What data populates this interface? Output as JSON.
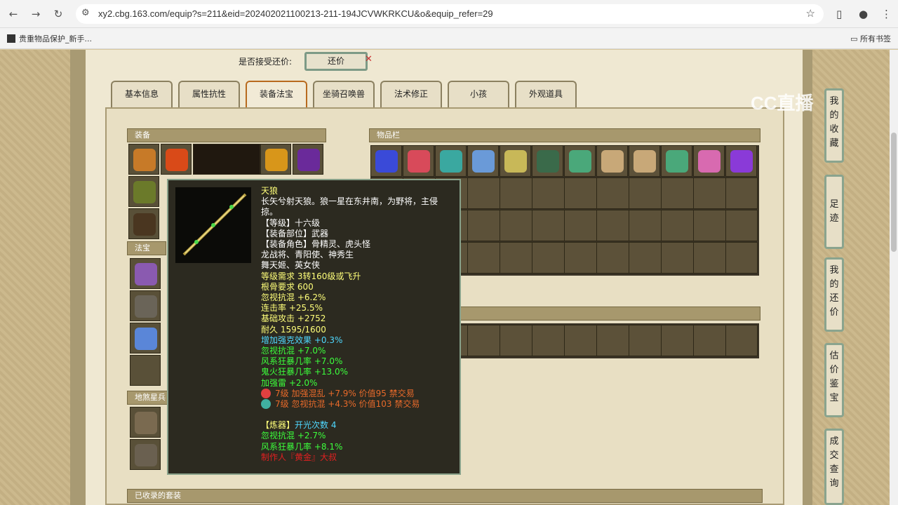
{
  "browser": {
    "url": "xy2.cbg.163.com/equip?s=211&eid=202402021100213-211-194JCVWKRKCU&o&equip_refer=29",
    "bookmark": "贵重物品保护_新手...",
    "all_bookmarks": "所有书签"
  },
  "offer": {
    "label": "是否接受还价:",
    "button": "还价"
  },
  "watermark": "CC直播",
  "tabs": [
    "基本信息",
    "属性抗性",
    "装备法宝",
    "坐骑召唤兽",
    "法术修正",
    "小孩",
    "外观道具"
  ],
  "sections": {
    "equip": "装备",
    "fabao": "法宝",
    "earth": "地煞星兵",
    "items": "物品栏",
    "suits": "已收录的套装"
  },
  "right_buttons": [
    "我的收藏",
    "足迹",
    "我的还价",
    "估价鉴宝",
    "成交查询"
  ],
  "tooltip": {
    "name": "天狼",
    "desc": "长矢兮射天狼。狼一星在东井南，为野将，主侵掠。",
    "level": "【等级】十六级",
    "slot": "【装备部位】武器",
    "roles": "【装备角色】骨精灵、虎头怪",
    "roles2": "龙战将、青阳使、神秀生",
    "roles3": "舞天姬、英女侠",
    "req_level": "等级需求 3转160级或飞升",
    "req_bone": "根骨要求 600",
    "attrs": [
      "忽视抗混 +6.2%",
      "连击率 +25.5%",
      "基础攻击 +2752",
      "耐久 1595/1600"
    ],
    "cyan": "增加强克效果 +0.3%",
    "green": [
      "忽视抗混 +7.0%",
      "风系狂暴几率 +7.0%",
      "鬼火狂暴几率 +13.0%",
      "加强雷 +2.0%"
    ],
    "gems": [
      "7级 加强混乱 +7.9% 价值95 禁交易",
      "7级 忽视抗混 +4.3% 价值103 禁交易"
    ],
    "refine_label": "【炼器】",
    "refine_value": "开光次数 4",
    "refine": [
      "忽视抗混 +2.7%",
      "风系狂暴几率 +8.1%"
    ],
    "maker": "制作人『黄金』大叔"
  },
  "colors": {
    "frame": "#a89a73",
    "tooltip_bg": "#2c2a20",
    "tooltip_border": "#88a18a",
    "tab_active": "#b86a1e"
  }
}
